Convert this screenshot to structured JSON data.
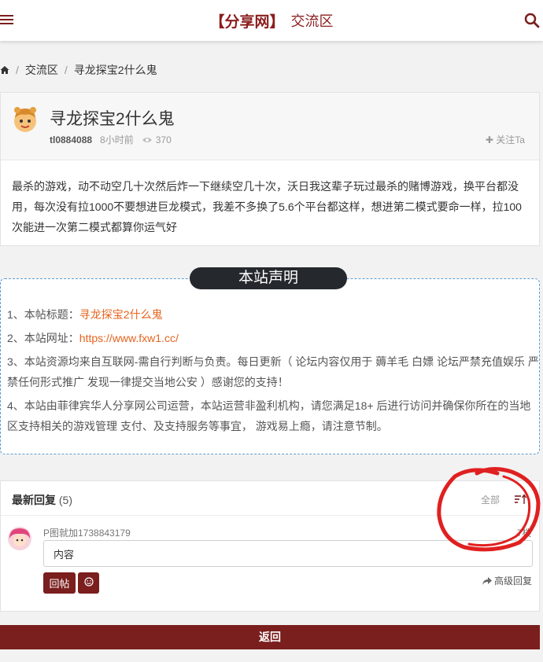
{
  "header": {
    "brand": "【分享网】",
    "section": "交流区"
  },
  "breadcrumb": {
    "items": [
      "交流区",
      "寻龙探宝2什么鬼"
    ]
  },
  "post": {
    "title": "寻龙探宝2什么鬼",
    "author": "tl0884088",
    "time": "8小时前",
    "views": "370",
    "follow_label": "✚ 关注Ta",
    "body": "最杀的游戏，动不动空几十次然后炸一下继续空几十次，沃日我这辈子玩过最杀的赌博游戏，换平台都没用，每次没有拉1000不要想进巨龙模式，我差不多换了5.6个平台都这样，想进第二模式要命一样，拉100次能进一次第二模式都算你运气好"
  },
  "notice": {
    "title": "本站声明",
    "line1_prefix": "1、本帖标题：",
    "line1_value": "寻龙探宝2什么鬼",
    "line2_prefix": "2、本站网址：",
    "line2_value": "https://www.fxw1.cc/",
    "line3": "3、本站资源均来自互联网-需自行判断与负责。每日更新（ 论坛内容仅用于 薅羊毛 白嫖 论坛严禁充值娱乐 严禁任何形式推广 发现一律提交当地公安 ）感谢您的支持！",
    "line4": "4、本站由菲律宾华人分享网公司运营，本站运营非盈利机构，请您满足18+ 后进行访问并确保你所在的当地区支持相关的游戏管理 支付、及支持服务等事宜， 游戏易上瘾，请注意节制。"
  },
  "replies": {
    "title": "最新回复",
    "count": "(5)",
    "filter_label": "全部",
    "user": "P图就加1738843179",
    "floor": "7楼",
    "input_value": "内容",
    "submit_label": "回帖",
    "advanced_label": "高级回复"
  },
  "footer": {
    "back_label": "返回"
  },
  "colors": {
    "brand": "#7a1e1e",
    "accent": "#e5641e",
    "annotation": "#e02020"
  }
}
